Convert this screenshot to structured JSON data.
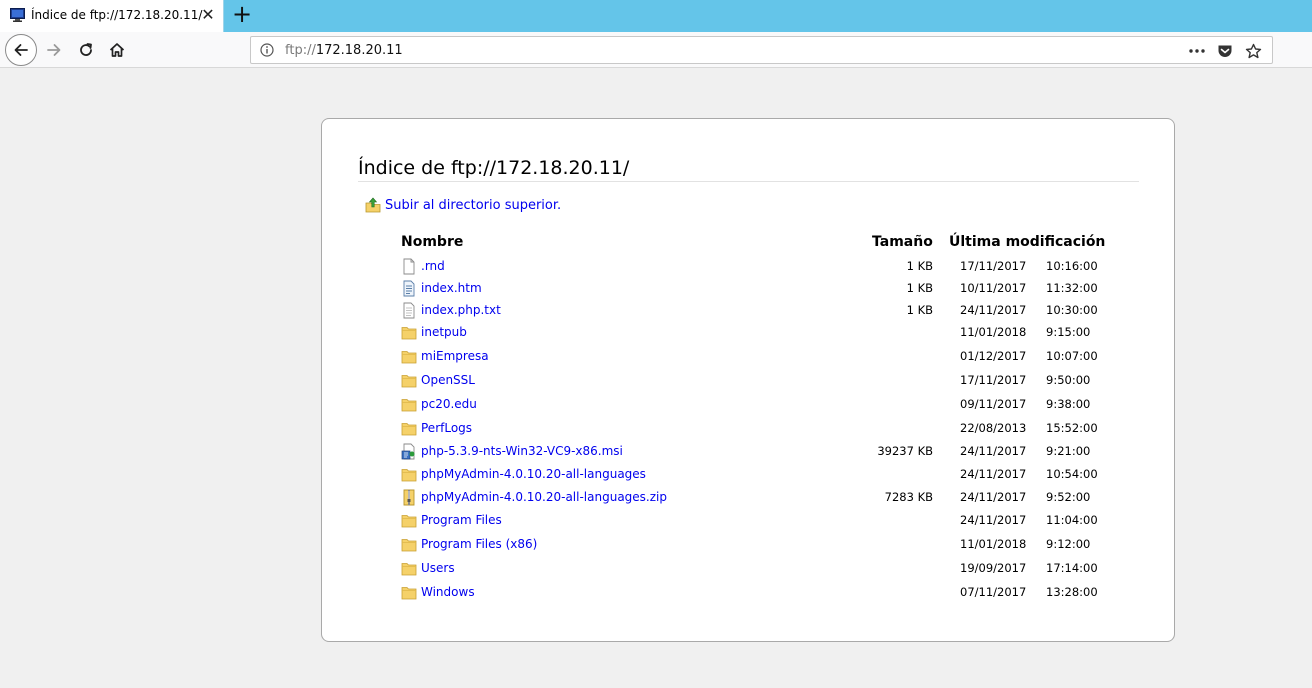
{
  "tab": {
    "title": "Índice de ftp://172.18.20.11/",
    "close": "✕",
    "new_tab": "+"
  },
  "urlbar": {
    "scheme": "ftp://",
    "host": "172.18.20.11"
  },
  "page": {
    "heading": "Índice de ftp://172.18.20.11/",
    "up_link": "Subir al directorio superior.",
    "columns": {
      "name": "Nombre",
      "size": "Tamaño",
      "modified": "Última modificación"
    },
    "rows": [
      {
        "name": ".rnd",
        "size": "1 KB",
        "date": "17/11/2017",
        "time": "10:16:00",
        "icon": "file-icon"
      },
      {
        "name": "index.htm",
        "size": "1 KB",
        "date": "10/11/2017",
        "time": "11:32:00",
        "icon": "html-file-icon"
      },
      {
        "name": "index.php.txt",
        "size": "1 KB",
        "date": "24/11/2017",
        "time": "10:30:00",
        "icon": "text-file-icon"
      },
      {
        "name": "inetpub",
        "size": "",
        "date": "11/01/2018",
        "time": "9:15:00",
        "icon": "folder-icon"
      },
      {
        "name": "miEmpresa",
        "size": "",
        "date": "01/12/2017",
        "time": "10:07:00",
        "icon": "folder-icon"
      },
      {
        "name": "OpenSSL",
        "size": "",
        "date": "17/11/2017",
        "time": "9:50:00",
        "icon": "folder-icon"
      },
      {
        "name": "pc20.edu",
        "size": "",
        "date": "09/11/2017",
        "time": "9:38:00",
        "icon": "folder-icon"
      },
      {
        "name": "PerfLogs",
        "size": "",
        "date": "22/08/2013",
        "time": "15:52:00",
        "icon": "folder-icon"
      },
      {
        "name": "php-5.3.9-nts-Win32-VC9-x86.msi",
        "size": "39237 KB",
        "date": "24/11/2017",
        "time": "9:21:00",
        "icon": "installer-icon"
      },
      {
        "name": "phpMyAdmin-4.0.10.20-all-languages",
        "size": "",
        "date": "24/11/2017",
        "time": "10:54:00",
        "icon": "folder-icon"
      },
      {
        "name": "phpMyAdmin-4.0.10.20-all-languages.zip",
        "size": "7283 KB",
        "date": "24/11/2017",
        "time": "9:52:00",
        "icon": "zip-file-icon"
      },
      {
        "name": "Program Files",
        "size": "",
        "date": "24/11/2017",
        "time": "11:04:00",
        "icon": "folder-icon"
      },
      {
        "name": "Program Files (x86)",
        "size": "",
        "date": "11/01/2018",
        "time": "9:12:00",
        "icon": "folder-icon"
      },
      {
        "name": "Users",
        "size": "",
        "date": "19/09/2017",
        "time": "17:14:00",
        "icon": "folder-icon"
      },
      {
        "name": "Windows",
        "size": "",
        "date": "07/11/2017",
        "time": "13:28:00",
        "icon": "folder-icon"
      }
    ]
  },
  "colors": {
    "tabstrip": "#64c5e9",
    "link": "#0000ee",
    "folder": "#f5d169"
  }
}
